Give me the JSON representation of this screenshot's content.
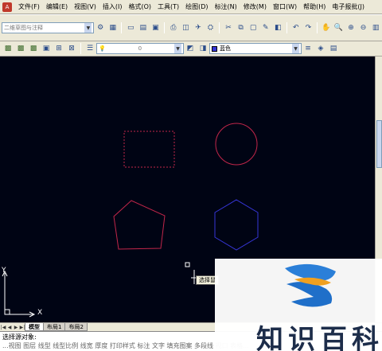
{
  "menu": {
    "items": [
      "文件(F)",
      "编辑(E)",
      "视图(V)",
      "插入(I)",
      "格式(O)",
      "工具(T)",
      "绘图(D)",
      "标注(N)",
      "修改(M)",
      "窗口(W)",
      "帮助(H)",
      "电子报批(J)"
    ]
  },
  "toolbar": {
    "workspace_value": "二维草图与注释",
    "layer_value": "0",
    "color_value": "蓝色"
  },
  "canvas": {
    "ucs_y_label": "Y",
    "ucs_x_label": "X",
    "tooltip_text": "选择鼠"
  },
  "tabs": {
    "model": "模型",
    "layout1": "布局1",
    "layout2": "布局2"
  },
  "command": {
    "prompt": "选择源对象:",
    "history": "...视图 图层 线型 线型比例 线宽 厚度 打印样式 标注 文字 填充图案 多段线 视口 表格..."
  },
  "watermark": {
    "text": "知识百科"
  },
  "colors": {
    "canvas_bg": "#000414",
    "rectangle": "#c2264a",
    "circle": "#c2264a",
    "pentagon": "#c2264a",
    "hexagon": "#3636d8",
    "logo_blue": "#2b7fd8",
    "logo_orange": "#f0a020"
  }
}
